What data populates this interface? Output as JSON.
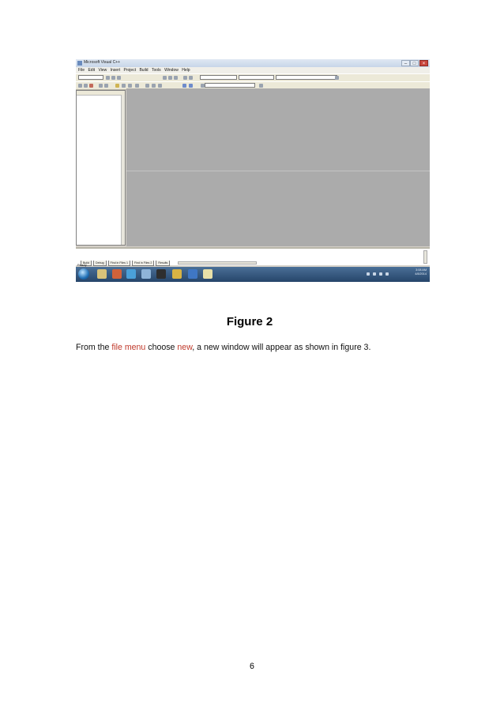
{
  "screenshot": {
    "window_title": "Microsoft Visual C++",
    "window_controls": [
      "–",
      "□",
      "×"
    ],
    "menu": [
      "File",
      "Edit",
      "View",
      "Insert",
      "Project",
      "Build",
      "Tools",
      "Window",
      "Help"
    ],
    "output_tabs": [
      "Build",
      "Debug",
      "Find in Files 1",
      "Find in Files 2",
      "Results"
    ],
    "status_text": "Ready",
    "tray_time": "3:08 AM",
    "tray_date": "4/8/2014"
  },
  "figure": {
    "caption": "Figure 2"
  },
  "paragraph": {
    "part1": "From the ",
    "file_menu": "file menu",
    "part2": " choose ",
    "new": "new",
    "part3": ", a new window will appear as shown in figure 3."
  },
  "page_number": "6",
  "colors": {
    "highlight": "#c0392b",
    "mdi_background": "#ababab",
    "taskbar": "#26456a"
  }
}
